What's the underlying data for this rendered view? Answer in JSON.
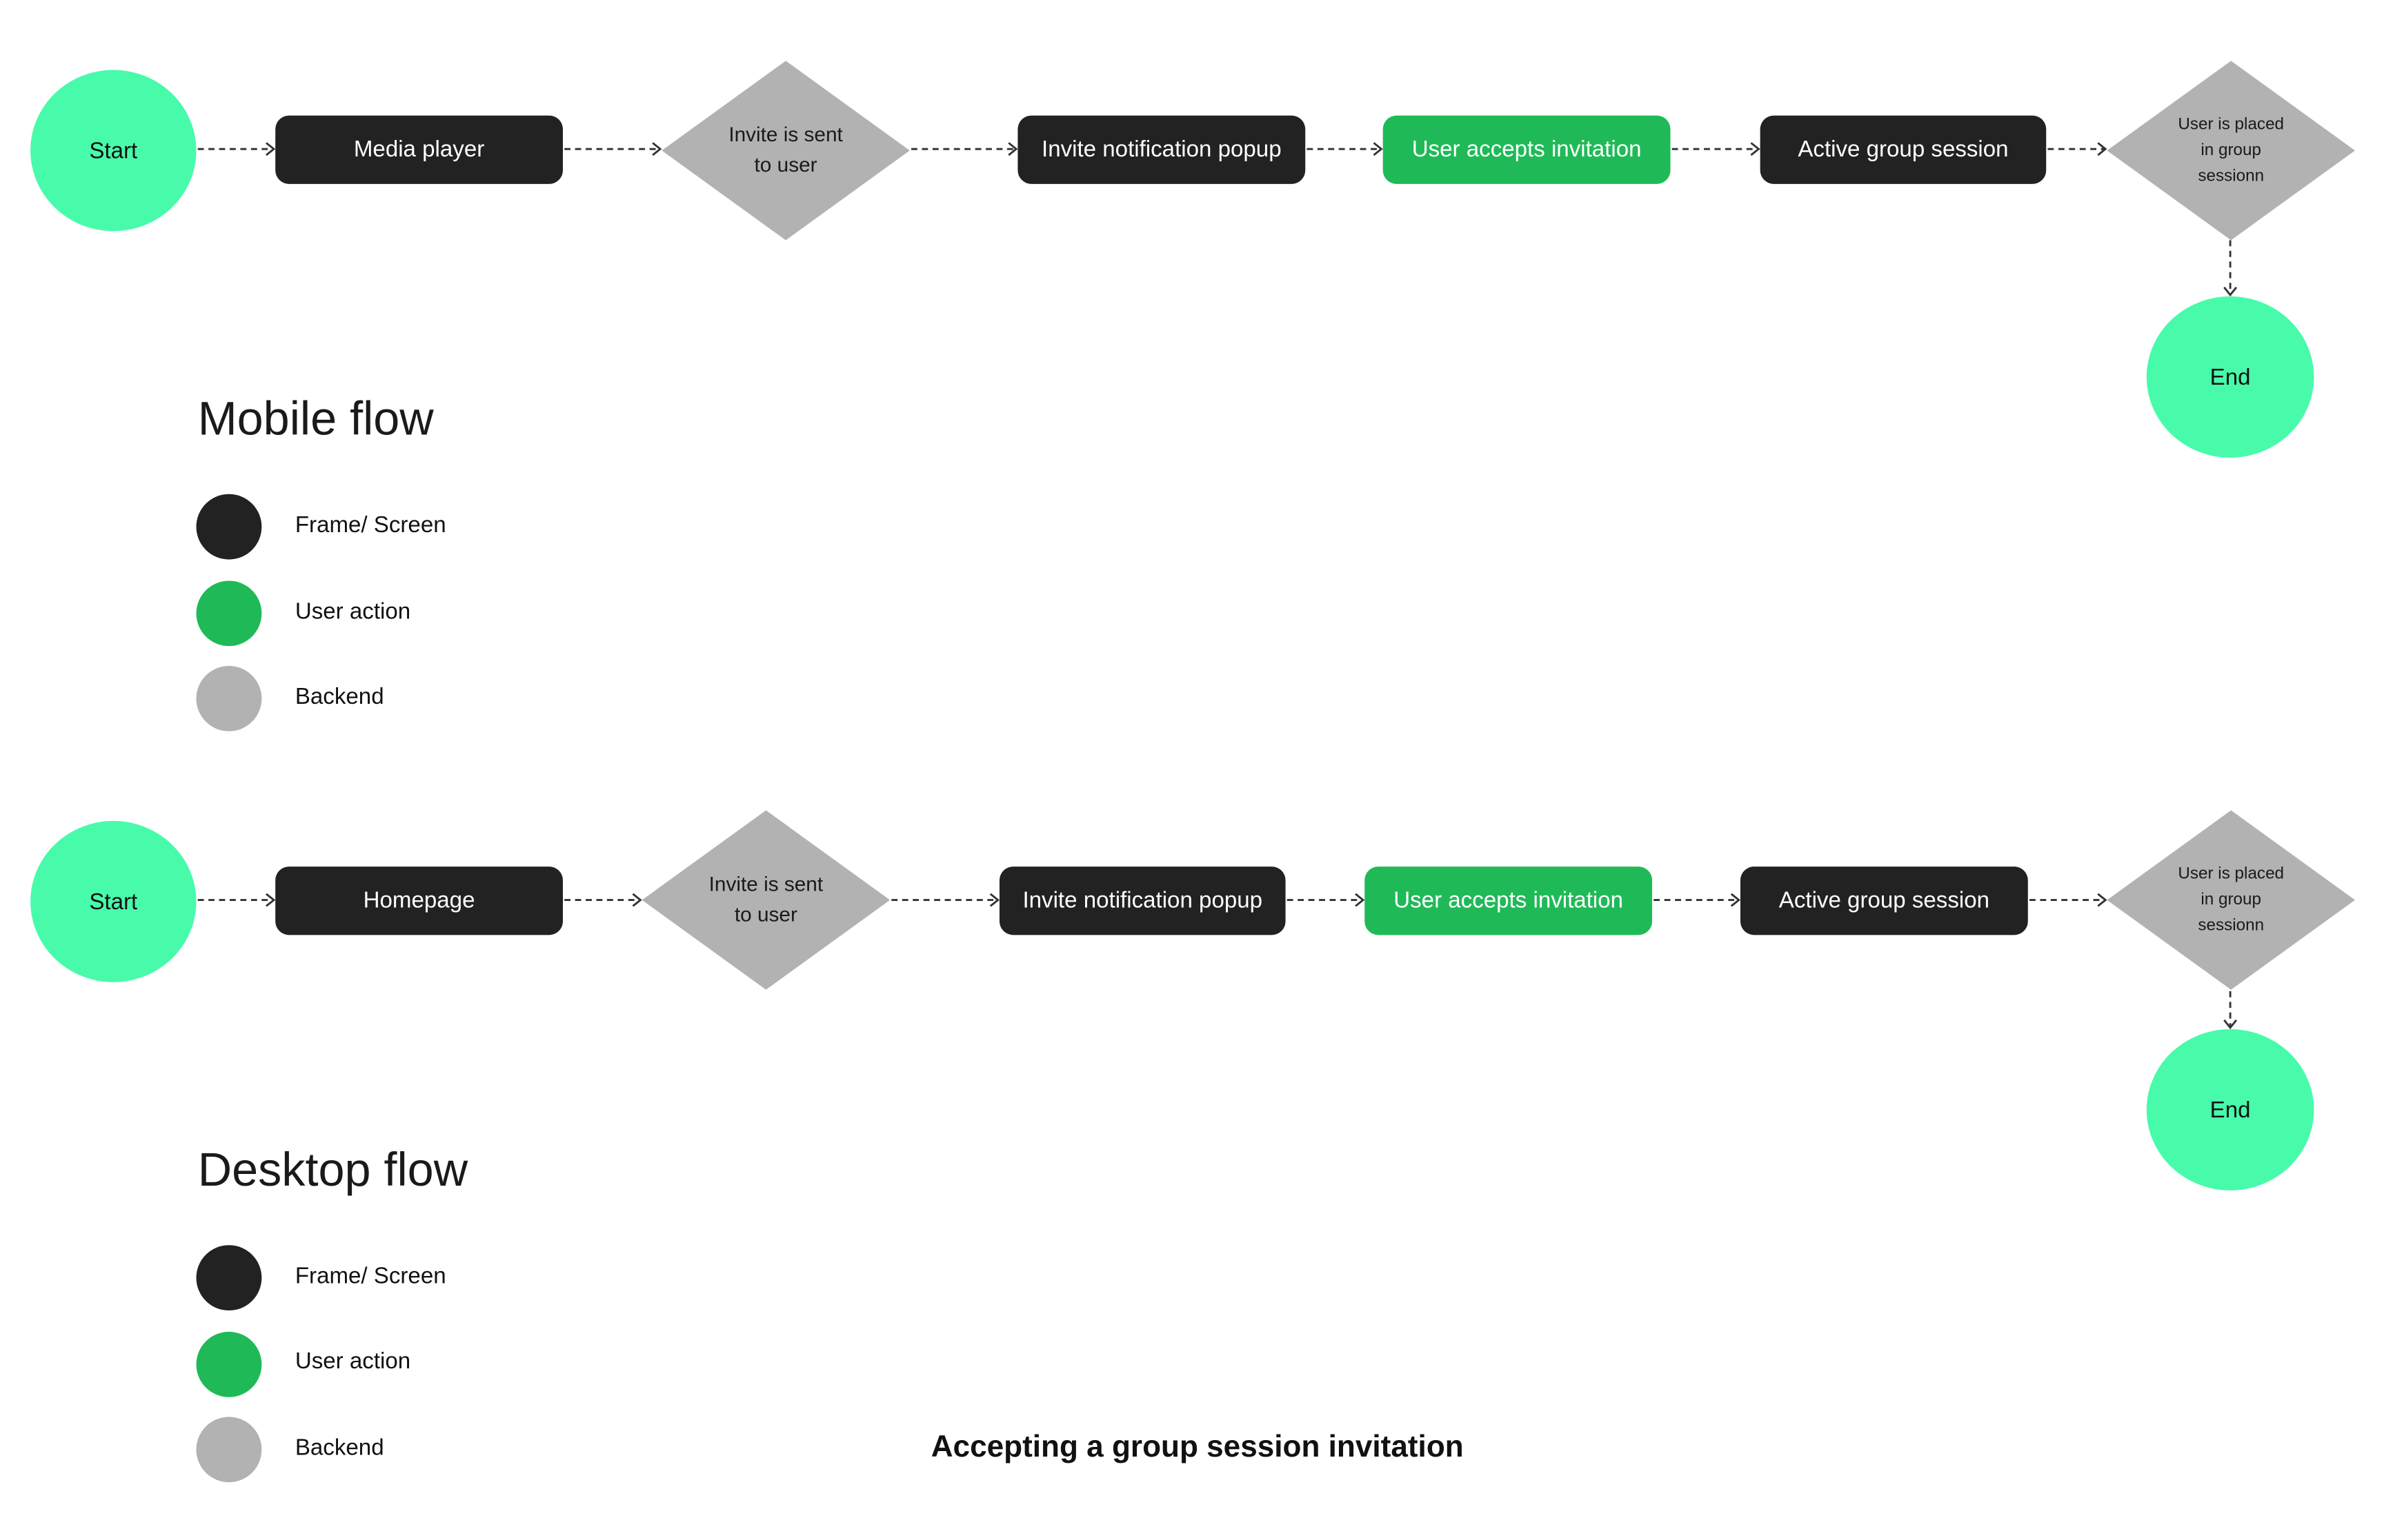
{
  "colors": {
    "start_end": "#47fbab",
    "frame": "#222222",
    "user_action": "#1fba57",
    "backend": "#b2b2b2",
    "connector": "#333333"
  },
  "mobile": {
    "title": "Mobile flow",
    "start": "Start",
    "media_player": "Media player",
    "invite_sent": [
      "Invite is sent",
      "to user"
    ],
    "invite_popup": "Invite notification popup",
    "accepts": "User accepts invitation",
    "active_session": "Active group session",
    "placed": [
      "User is placed",
      "in group",
      "sessionn"
    ],
    "end": "End",
    "legend": [
      {
        "label": "Frame/ Screen",
        "color": "#222222"
      },
      {
        "label": "User action",
        "color": "#1fba57"
      },
      {
        "label": "Backend",
        "color": "#b2b2b2"
      }
    ]
  },
  "desktop": {
    "title": "Desktop flow",
    "start": "Start",
    "homepage": "Homepage",
    "invite_sent": [
      "Invite is sent",
      "to user"
    ],
    "invite_popup": "Invite notification popup",
    "accepts": "User accepts invitation",
    "active_session": "Active group session",
    "placed": [
      "User is placed",
      "in group",
      "sessionn"
    ],
    "end": "End",
    "legend": [
      {
        "label": "Frame/ Screen",
        "color": "#222222"
      },
      {
        "label": "User action",
        "color": "#1fba57"
      },
      {
        "label": "Backend",
        "color": "#b2b2b2"
      }
    ]
  },
  "caption": "Accepting a group session invitation"
}
